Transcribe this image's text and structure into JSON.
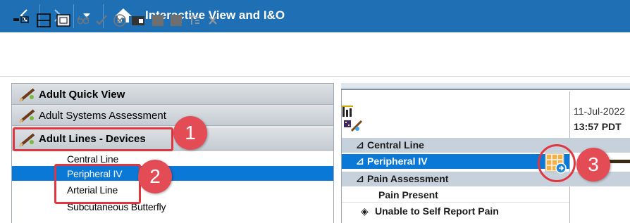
{
  "window": {
    "title": "Interactive View and I&O"
  },
  "titlebar": {
    "back_icon": "chevron-left-icon",
    "forward_icon": "chevron-right-icon",
    "dropdown_icon": "caret-down-icon",
    "home_icon": "home-icon"
  },
  "toolbar": {
    "icons": [
      "insert-icon",
      "split-view-icon",
      "add-column-icon",
      "glasses-icon",
      "checkmark-icon",
      "cancel-circle-icon",
      "folder-icon",
      "grey-square-icon",
      "grey-square-icon",
      "text-icon",
      "close-x-icon"
    ]
  },
  "navigator": {
    "bands": [
      {
        "label": "Adult Quick View",
        "bold": true
      },
      {
        "label": "Adult Systems Assessment",
        "bold": false
      },
      {
        "label": "Adult Lines - Devices",
        "bold": true
      }
    ],
    "sections": [
      {
        "label": "Central Line"
      },
      {
        "label": "Peripheral IV",
        "selected": true
      },
      {
        "label": "Arterial Line"
      },
      {
        "label": "Subcutaneous Butterfly"
      }
    ]
  },
  "flowsheet": {
    "date": "11-Jul-2022",
    "time": "13:57 PDT",
    "rows": [
      {
        "label": "Central Line",
        "prefix": "⊿",
        "style": "section"
      },
      {
        "label": "Peripheral IV",
        "prefix": "⊿",
        "style": "selected"
      },
      {
        "label": "Pain Assessment",
        "prefix": "⊿",
        "style": "section"
      },
      {
        "label": "Pain Present",
        "prefix": "",
        "style": "plain"
      },
      {
        "label": "Unable to Self Report Pain",
        "prefix": "◈",
        "style": "plain"
      }
    ]
  },
  "callouts": [
    "1",
    "2",
    "3"
  ],
  "colors": {
    "titlebar": "#1f6fb5",
    "selection": "#0a78d7",
    "callout_red": "#e0363f",
    "callout_badge": "#e34c55"
  }
}
